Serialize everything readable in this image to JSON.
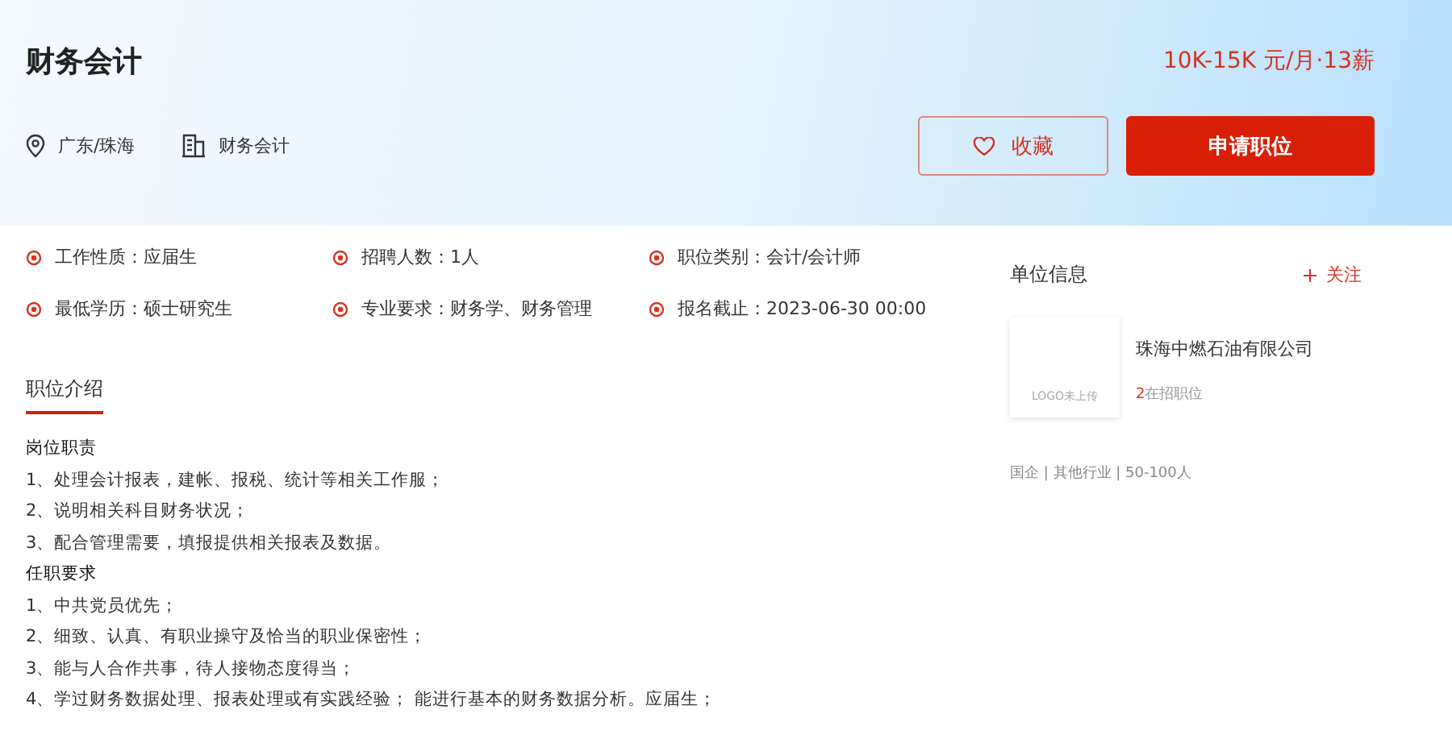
{
  "job": {
    "title": "财务会计",
    "salary": "10K-15K 元/月·13薪",
    "location": "广东/珠海",
    "category": "财务会计"
  },
  "actions": [
    {
      "kind": "favorite",
      "label": "收藏"
    },
    {
      "kind": "apply",
      "label": "申请职位"
    }
  ],
  "facts": [
    {
      "label": "工作性质：",
      "value": "应届生"
    },
    {
      "label": "招聘人数：",
      "value": "1人"
    },
    {
      "label": "职位类别：",
      "value": "会计/会计师"
    },
    {
      "label": "最低学历：",
      "value": "硕士研究生"
    },
    {
      "label": "专业要求：",
      "value": "财务学、财务管理"
    },
    {
      "label": "报名截止：",
      "value": "2023-06-30 00:00"
    }
  ],
  "description": {
    "heading": "职位介绍",
    "lines": [
      {
        "kind": "heading",
        "text": "岗位职责"
      },
      {
        "kind": "item",
        "text": "1、处理会计报表，建帐、报税、统计等相关工作服；"
      },
      {
        "kind": "item",
        "text": "2、说明相关科目财务状况；"
      },
      {
        "kind": "item",
        "text": "3、配合管理需要，填报提供相关报表及数据。"
      },
      {
        "kind": "heading",
        "text": "任职要求"
      },
      {
        "kind": "item",
        "text": "1、中共党员优先；"
      },
      {
        "kind": "item",
        "text": "2、细致、认真、有职业操守及恰当的职业保密性；"
      },
      {
        "kind": "item",
        "text": "3、能与人合作共事，待人接物态度得当；"
      },
      {
        "kind": "item",
        "text": "4、学过财务数据处理、报表处理或有实践经验； 能进行基本的财务数据分析。应届生；"
      }
    ]
  },
  "company": {
    "heading": "单位信息",
    "follow": "关注",
    "logo": "LOGO未上传",
    "name": "珠海中燃石油有限公司",
    "open_count": "2",
    "open_label": "在招职位",
    "profile": "国企 | 其他行业 | 50-100人"
  }
}
